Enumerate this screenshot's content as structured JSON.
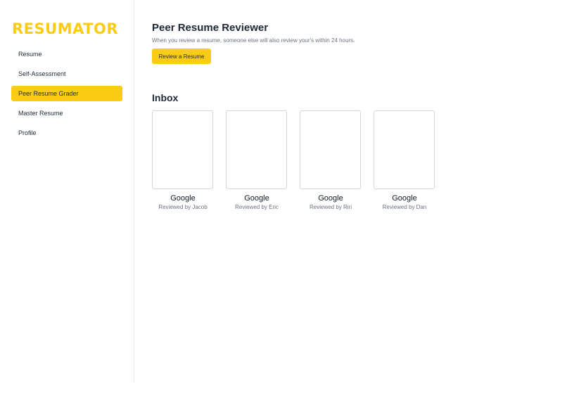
{
  "app": {
    "logo": "RESUMATOR"
  },
  "sidebar": {
    "items": [
      {
        "label": "Resume"
      },
      {
        "label": "Self-Assessment"
      },
      {
        "label": "Peer Resume Grader"
      },
      {
        "label": "Master Resume"
      },
      {
        "label": "Profile"
      }
    ],
    "active_index": 2
  },
  "main": {
    "title": "Peer Resume Reviewer",
    "subtitle": "When you review a resume, someone else will also review your's within 24 hours.",
    "review_button": "Review a Resume",
    "inbox_title": "Inbox",
    "inbox": [
      {
        "company": "Google",
        "reviewer": "Reviewed by Jacob"
      },
      {
        "company": "Google",
        "reviewer": "Reviewed by Eric"
      },
      {
        "company": "Google",
        "reviewer": "Reviewed by Riri"
      },
      {
        "company": "Google",
        "reviewer": "Reviewed by Dan"
      }
    ]
  },
  "colors": {
    "accent": "#facc15",
    "text": "#1f2937",
    "muted": "#6b7280",
    "border": "#d4d4d8"
  }
}
